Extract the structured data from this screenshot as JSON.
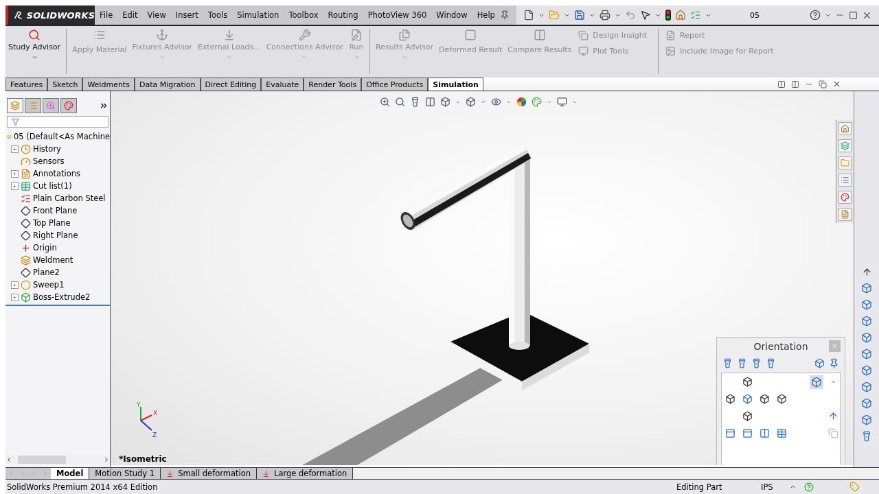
{
  "app": {
    "logo": "SOLIDWORKS",
    "document": "05"
  },
  "menu": [
    "File",
    "Edit",
    "View",
    "Insert",
    "Tools",
    "Simulation",
    "Toolbox",
    "Routing",
    "PhotoView 360",
    "Window",
    "Help"
  ],
  "ribbon": {
    "large": [
      {
        "label": "Study Advisor",
        "disabled": false,
        "has_menu": true
      },
      {
        "label": "Apply Material",
        "disabled": true,
        "has_menu": false
      },
      {
        "label": "Fixtures Advisor",
        "disabled": true,
        "has_menu": true
      },
      {
        "label": "External Loads...",
        "disabled": true,
        "has_menu": true
      },
      {
        "label": "Connections Advisor",
        "disabled": true,
        "has_menu": true
      },
      {
        "label": "Run",
        "disabled": true,
        "has_menu": true
      },
      {
        "label": "Results Advisor",
        "disabled": true,
        "has_menu": true
      },
      {
        "label": "Deformed Result",
        "disabled": true,
        "has_menu": false
      },
      {
        "label": "Compare Results",
        "disabled": true,
        "has_menu": false
      }
    ],
    "small": [
      {
        "label": "Design Insight",
        "disabled": true
      },
      {
        "label": "Plot Tools",
        "disabled": true
      }
    ],
    "report": [
      {
        "label": "Report",
        "disabled": true
      },
      {
        "label": "Include Image for Report",
        "disabled": true
      }
    ]
  },
  "command_tabs": [
    {
      "label": "Features",
      "selected": false
    },
    {
      "label": "Sketch",
      "selected": false
    },
    {
      "label": "Weldments",
      "selected": false
    },
    {
      "label": "Data Migration",
      "selected": false
    },
    {
      "label": "Direct Editing",
      "selected": false
    },
    {
      "label": "Evaluate",
      "selected": false
    },
    {
      "label": "Render Tools",
      "selected": false
    },
    {
      "label": "Office Products",
      "selected": false
    },
    {
      "label": "Simulation",
      "selected": true
    }
  ],
  "feature_tree": {
    "pane_tabs": [
      {
        "selected": true
      },
      {
        "selected": false
      },
      {
        "selected": false
      },
      {
        "selected": false
      }
    ],
    "root": "05  (Default<As Machine",
    "items": [
      {
        "label": "History",
        "expandable": true
      },
      {
        "label": "Sensors",
        "expandable": false
      },
      {
        "label": "Annotations",
        "expandable": true
      },
      {
        "label": "Cut list(1)",
        "expandable": true
      },
      {
        "label": "Plain Carbon Steel",
        "expandable": false
      },
      {
        "label": "Front Plane",
        "expandable": false
      },
      {
        "label": "Top Plane",
        "expandable": false
      },
      {
        "label": "Right Plane",
        "expandable": false
      },
      {
        "label": "Origin",
        "expandable": false
      },
      {
        "label": "Weldment",
        "expandable": false
      },
      {
        "label": "Plane2",
        "expandable": false
      },
      {
        "label": "Sweep1",
        "expandable": true
      },
      {
        "label": "Boss-Extrude2",
        "expandable": true
      }
    ]
  },
  "viewport": {
    "view_label": "*Isometric",
    "triad": [
      "Y",
      "X",
      "Z"
    ]
  },
  "orientation": {
    "title": "Orientation"
  },
  "bottom_tabs": [
    {
      "label": "Model",
      "selected": true,
      "kind": "model"
    },
    {
      "label": "Motion Study 1",
      "selected": false,
      "kind": "motion"
    },
    {
      "label": "Small deformation",
      "selected": false,
      "kind": "study"
    },
    {
      "label": "Large deformation",
      "selected": false,
      "kind": "study"
    }
  ],
  "status": {
    "edition": "SolidWorks Premium 2014 x64 Edition",
    "mode": "Editing Part",
    "units": "IPS"
  }
}
